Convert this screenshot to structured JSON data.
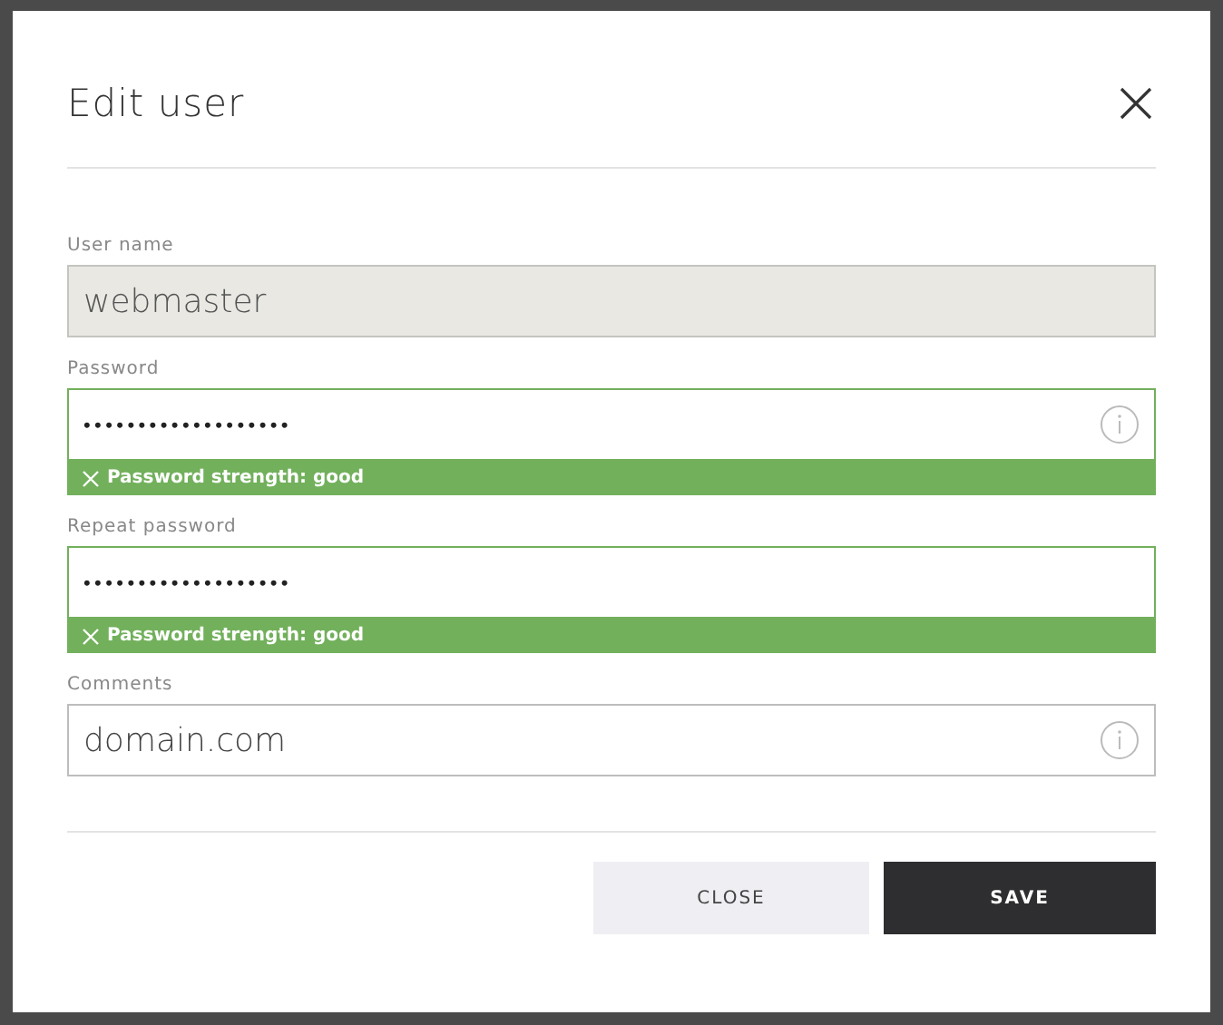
{
  "dialog": {
    "title": "Edit user"
  },
  "fields": [
    {
      "label": "User name",
      "value": "webmaster",
      "disabled": true,
      "info": false
    },
    {
      "label": "Password",
      "value": "•••••••••••••••••••",
      "disabled": false,
      "info": true,
      "strength": {
        "text": "Password strength: good",
        "ok": true
      }
    },
    {
      "label": "Repeat password",
      "value": "•••••••••••••••••••",
      "disabled": false,
      "info": false,
      "strength": {
        "text": "Password strength: good",
        "ok": true
      }
    },
    {
      "label": "Comments",
      "value": "domain.com",
      "disabled": false,
      "info": true
    }
  ],
  "buttons": [
    {
      "label": "CLOSE",
      "kind": "secondary"
    },
    {
      "label": "SAVE",
      "kind": "primary"
    }
  ]
}
